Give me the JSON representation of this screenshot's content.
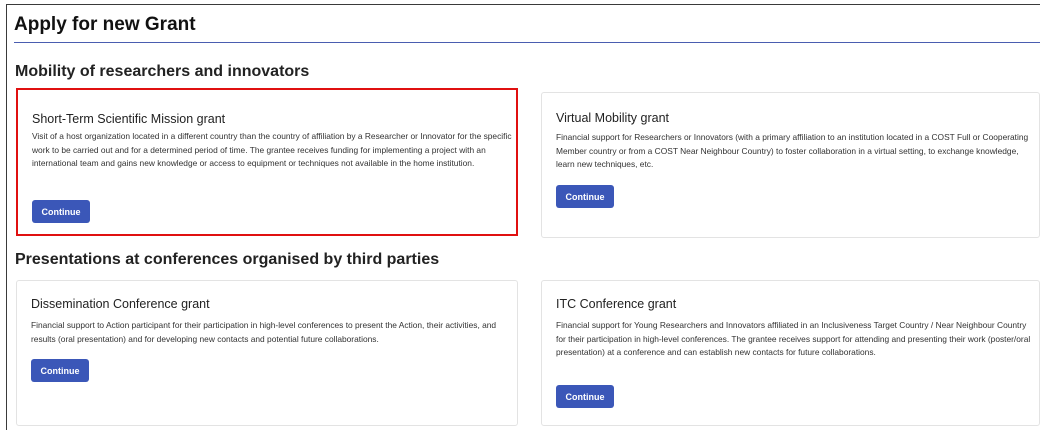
{
  "page": {
    "title": "Apply for new Grant"
  },
  "sections": [
    {
      "title": "Mobility of researchers and innovators",
      "cards": [
        {
          "title": "Short-Term Scientific Mission grant",
          "description": "Visit of a host organization located in a different country than the country of affiliation by a Researcher or Innovator for the specific work to be carried out and for a determined period of time. The grantee receives funding for implementing a project with an international team and gains new knowledge or access to equipment or techniques not available in the home institution.",
          "button": "Continue"
        },
        {
          "title": "Virtual Mobility grant",
          "description": "Financial support for Researchers or Innovators (with a primary affiliation to an institution located in a COST Full or Cooperating Member country or from a COST Near Neighbour Country) to foster collaboration in a virtual setting, to exchange knowledge, learn new techniques, etc.",
          "button": "Continue"
        }
      ]
    },
    {
      "title": "Presentations at conferences organised by third parties",
      "cards": [
        {
          "title": "Dissemination Conference grant",
          "description": "Financial support to Action participant for their participation in high-level conferences to present the Action, their activities, and results (oral presentation) and for developing new contacts and potential future collaborations.",
          "button": "Continue"
        },
        {
          "title": "ITC Conference grant",
          "description": "Financial support for Young Researchers and Innovators affiliated in an Inclusiveness Target Country / Near Neighbour Country for their participation in high-level conferences. The grantee receives support for attending and presenting their work (poster/oral presentation) at a conference and can establish new contacts for future collaborations.",
          "button": "Continue"
        }
      ]
    }
  ],
  "colors": {
    "accent": "#3b57b8",
    "highlight": "#e01010",
    "rule": "#4a5db0"
  }
}
